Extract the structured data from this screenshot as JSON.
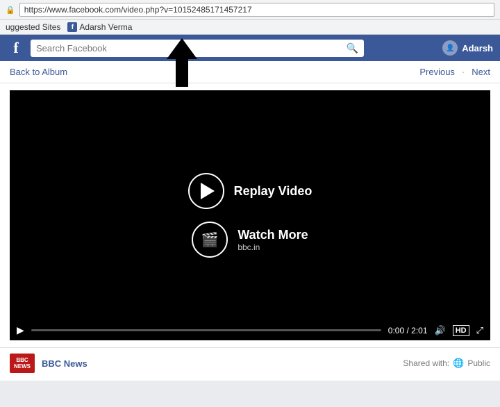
{
  "browser": {
    "url": "https://www.facebook.com/video.php?v=10152485171457217",
    "lock_icon": "🔒",
    "bookmarks": [
      {
        "label": "uggested Sites",
        "id": "suggested"
      },
      {
        "label": "Adarsh Verma",
        "id": "adarsh",
        "has_favicon": true
      }
    ]
  },
  "header": {
    "logo": "f",
    "search_placeholder": "Search Facebook",
    "user": {
      "name": "Adarsh"
    }
  },
  "nav": {
    "back_label": "Back to Album",
    "previous_label": "Previous",
    "next_label": "Next"
  },
  "video": {
    "replay_label": "Replay Video",
    "watch_more_label": "Watch More",
    "watch_more_subtitle": "bbc.in",
    "time_current": "0:00",
    "time_total": "2:01",
    "quality_label": "HD"
  },
  "post": {
    "source_name": "BBC News",
    "source_logo_line1": "BBC",
    "source_logo_line2": "NEWS",
    "shared_label": "Shared with:",
    "visibility_label": "Public"
  },
  "icons": {
    "search": "🔍",
    "play": "▶",
    "volume": "🔊",
    "fullscreen": "⛶",
    "globe": "🌐",
    "lock": "🔒"
  }
}
